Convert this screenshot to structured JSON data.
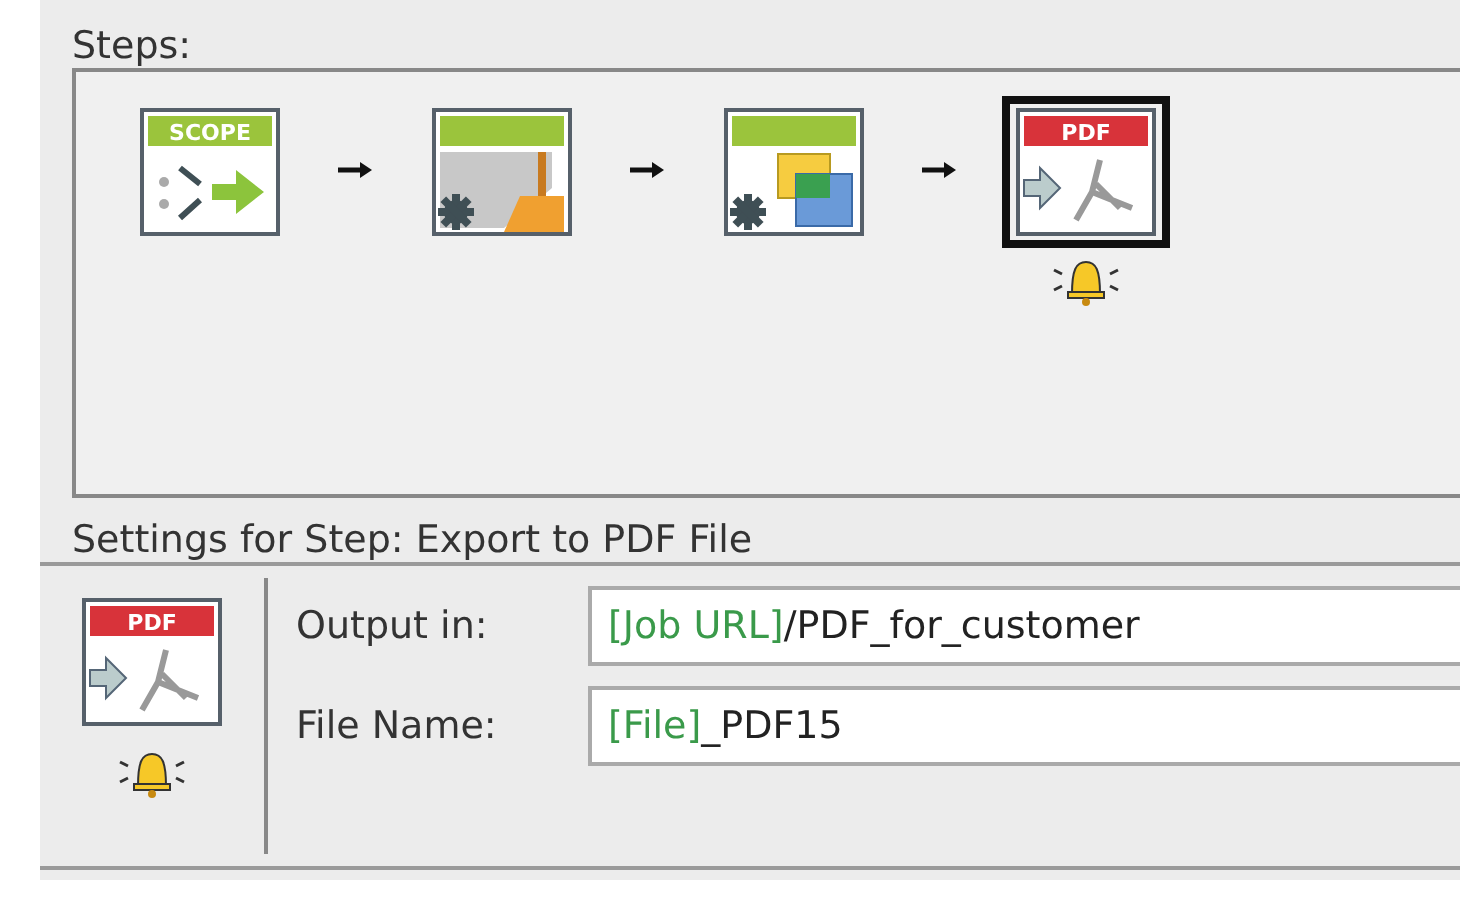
{
  "steps_label": "Steps:",
  "steps": [
    {
      "kind": "scope",
      "banner": "SCOPE",
      "selected": false,
      "alert": false
    },
    {
      "kind": "cleanup",
      "selected": false,
      "alert": false
    },
    {
      "kind": "layers",
      "selected": false,
      "alert": false
    },
    {
      "kind": "pdf",
      "banner": "PDF",
      "selected": true,
      "alert": true
    }
  ],
  "settings": {
    "title": "Settings for Step: Export to PDF File",
    "icon": {
      "kind": "pdf",
      "banner": "PDF",
      "alert": true
    },
    "fields": [
      {
        "label": "Output in:",
        "value": [
          {
            "kind": "variable",
            "text": "[Job URL]"
          },
          {
            "kind": "text",
            "text": "/PDF_for_customer"
          }
        ]
      },
      {
        "label": "File Name:",
        "value": [
          {
            "kind": "variable",
            "text": "[File]"
          },
          {
            "kind": "text",
            "text": "_PDF15"
          }
        ]
      }
    ]
  }
}
